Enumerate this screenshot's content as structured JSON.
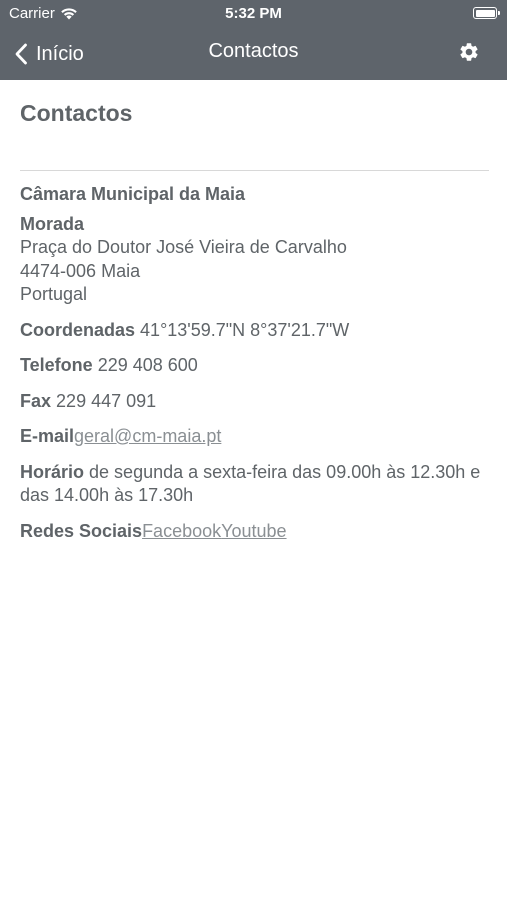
{
  "status": {
    "carrier": "Carrier",
    "time": "5:32 PM"
  },
  "nav": {
    "back_label": "Início",
    "title": "Contactos"
  },
  "page": {
    "title": "Contactos"
  },
  "contact": {
    "organization": "Câmara Municipal da Maia",
    "address": {
      "label": "Morada",
      "line1": "Praça do Doutor José Vieira de Carvalho",
      "line2": "4474-006 Maia",
      "line3": "Portugal"
    },
    "coordinates": {
      "label": "Coordenadas",
      "value": "41°13'59.7\"N 8°37'21.7\"W"
    },
    "phone": {
      "label": "Telefone",
      "value": "229 408 600"
    },
    "fax": {
      "label": "Fax",
      "value": "229 447 091"
    },
    "email": {
      "label": "E-mail",
      "value": "geral@cm-maia.pt"
    },
    "schedule": {
      "label": "Horário",
      "value": "de segunda a sexta-feira das 09.00h às 12.30h e das 14.00h às 17.30h"
    },
    "social": {
      "label": "Redes Sociais",
      "facebook": "Facebook",
      "youtube": "Youtube"
    }
  },
  "icons": {
    "wifi": "wifi-icon",
    "battery": "battery-icon",
    "back": "chevron-left-icon",
    "settings": "gear-icon"
  },
  "colors": {
    "bar": "#5e646b",
    "text": "#5f6468",
    "link": "#8a8f93",
    "divider": "#d8d8d8"
  }
}
